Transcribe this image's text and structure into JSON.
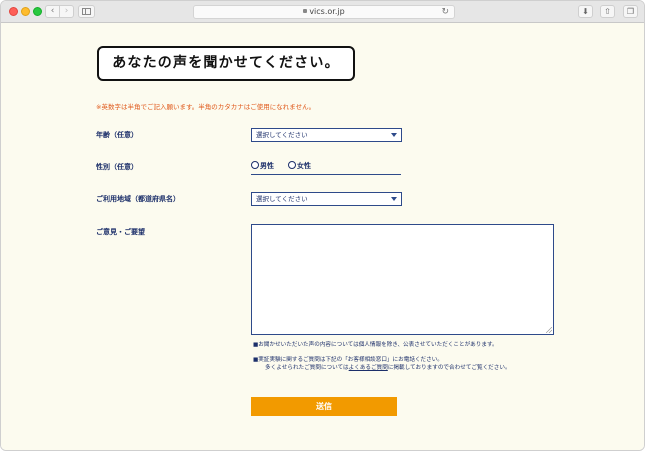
{
  "browser": {
    "url": "vics.or.jp",
    "back_glyph": "‹",
    "forward_glyph": "›",
    "reload_glyph": "↻",
    "download_glyph": "⬇",
    "share_glyph": "⇧",
    "tabs_glyph": "❐",
    "traffic_colors": [
      "#fe5f57",
      "#febc2e",
      "#28c840"
    ]
  },
  "page": {
    "title": "あなたの声を聞かせてください。",
    "note": "※英数字は半角でご記入願います。半角のカタカナはご使用になれません。",
    "background_color": "#fcfbef",
    "accent_color": "#f29a00",
    "label_color": "#1c2f6a",
    "note_color": "#e05a1c"
  },
  "form": {
    "age": {
      "label": "年齢（任意）",
      "selected": "選択してください"
    },
    "gender": {
      "label": "性別（任意）",
      "options": [
        "男性",
        "女性"
      ]
    },
    "area": {
      "label": "ご利用地域（都道府県名）",
      "selected": "選択してください"
    },
    "opinion": {
      "label": "ご意見・ご要望",
      "value": ""
    },
    "notes": {
      "line1": "■お聞かせいただいた声の内容については個人情報を除き、公表させていただくことがあります。",
      "line2": "■実証実験に関するご質問は下記の「お客様相談窓口」にお電話ください。",
      "line3_prefix": "多くよせられたご質問については",
      "line3_link": "よくあるご質問",
      "line3_suffix": "に掲載しておりますので合わせてご覧ください。"
    },
    "submit_label": "送信"
  }
}
